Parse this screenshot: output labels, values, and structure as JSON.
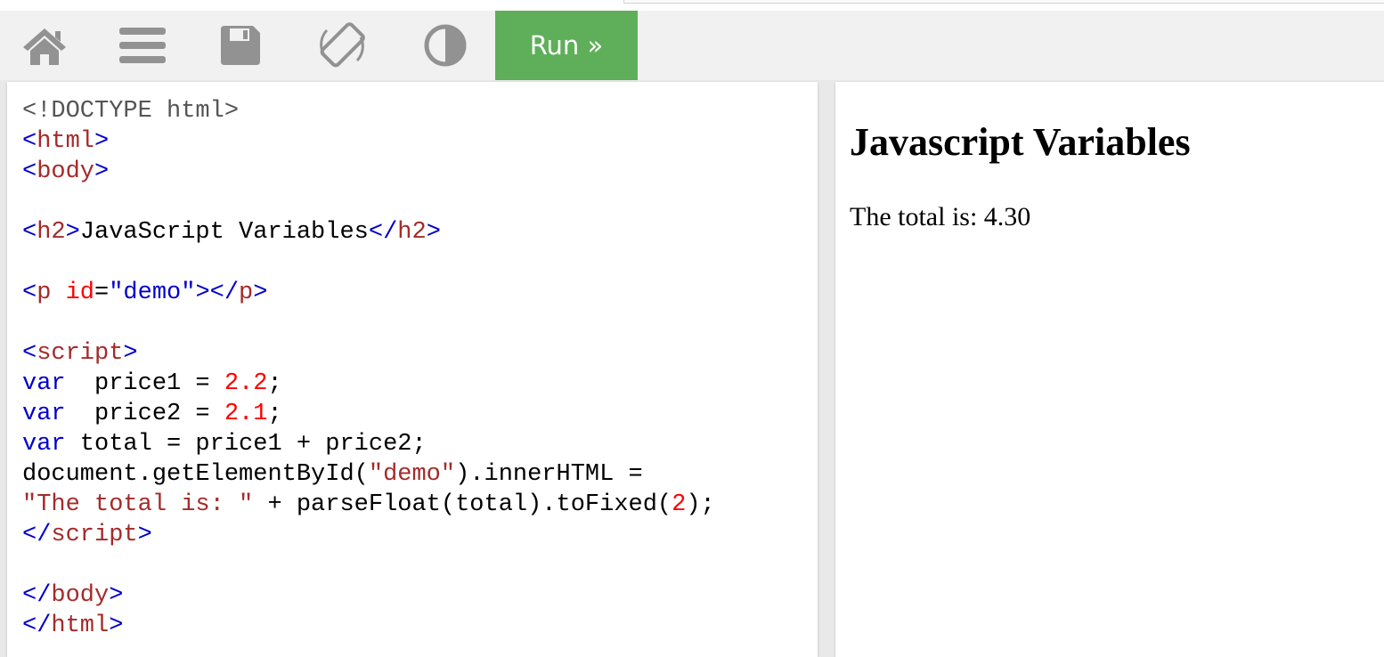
{
  "toolbar": {
    "buttons": [
      {
        "icon": "home-icon"
      },
      {
        "icon": "menu-icon"
      },
      {
        "icon": "save-icon"
      },
      {
        "icon": "rotate-icon"
      },
      {
        "icon": "contrast-icon"
      }
    ],
    "run_label": "Run »",
    "run_color": "#5fae5a",
    "icon_color": "#929292"
  },
  "editor": {
    "lines": [
      [
        {
          "t": "<!DOCTYPE html>",
          "c": "doctype"
        }
      ],
      [
        {
          "t": "<",
          "c": "bracket"
        },
        {
          "t": "html",
          "c": "tag"
        },
        {
          "t": ">",
          "c": "bracket"
        }
      ],
      [
        {
          "t": "<",
          "c": "bracket"
        },
        {
          "t": "body",
          "c": "tag"
        },
        {
          "t": ">",
          "c": "bracket"
        }
      ],
      [],
      [
        {
          "t": "<",
          "c": "bracket"
        },
        {
          "t": "h2",
          "c": "tag"
        },
        {
          "t": ">",
          "c": "bracket"
        },
        {
          "t": "JavaScript Variables",
          "c": "plain"
        },
        {
          "t": "</",
          "c": "bracket"
        },
        {
          "t": "h2",
          "c": "tag"
        },
        {
          "t": ">",
          "c": "bracket"
        }
      ],
      [],
      [
        {
          "t": "<",
          "c": "bracket"
        },
        {
          "t": "p",
          "c": "tag"
        },
        {
          "t": " ",
          "c": "plain"
        },
        {
          "t": "id",
          "c": "attr"
        },
        {
          "t": "=",
          "c": "plain"
        },
        {
          "t": "\"demo\"",
          "c": "attrval"
        },
        {
          "t": "></",
          "c": "bracket"
        },
        {
          "t": "p",
          "c": "tag"
        },
        {
          "t": ">",
          "c": "bracket"
        }
      ],
      [],
      [
        {
          "t": "<",
          "c": "bracket"
        },
        {
          "t": "script",
          "c": "tag"
        },
        {
          "t": ">",
          "c": "bracket"
        }
      ],
      [
        {
          "t": "var",
          "c": "kw"
        },
        {
          "t": "  price1 = ",
          "c": "plain"
        },
        {
          "t": "2.2",
          "c": "num"
        },
        {
          "t": ";",
          "c": "plain"
        }
      ],
      [
        {
          "t": "var",
          "c": "kw"
        },
        {
          "t": "  price2 = ",
          "c": "plain"
        },
        {
          "t": "2.1",
          "c": "num"
        },
        {
          "t": ";",
          "c": "plain"
        }
      ],
      [
        {
          "t": "var",
          "c": "kw"
        },
        {
          "t": " total = price1 + price2;",
          "c": "plain"
        }
      ],
      [
        {
          "t": "document.getElementById(",
          "c": "plain"
        },
        {
          "t": "\"demo\"",
          "c": "str"
        },
        {
          "t": ").innerHTML =",
          "c": "plain"
        }
      ],
      [
        {
          "t": "\"The total is: \"",
          "c": "str"
        },
        {
          "t": " + parseFloat(total).toFixed(",
          "c": "plain"
        },
        {
          "t": "2",
          "c": "num"
        },
        {
          "t": ");",
          "c": "plain"
        }
      ],
      [
        {
          "t": "</",
          "c": "bracket"
        },
        {
          "t": "script",
          "c": "tag"
        },
        {
          "t": ">",
          "c": "bracket"
        }
      ],
      [],
      [
        {
          "t": "</",
          "c": "bracket"
        },
        {
          "t": "body",
          "c": "tag"
        },
        {
          "t": ">",
          "c": "bracket"
        }
      ],
      [
        {
          "t": "</",
          "c": "bracket"
        },
        {
          "t": "html",
          "c": "tag"
        },
        {
          "t": ">",
          "c": "bracket"
        }
      ]
    ]
  },
  "result": {
    "title": "Javascript Variables",
    "text": "The total is: 4.30"
  }
}
